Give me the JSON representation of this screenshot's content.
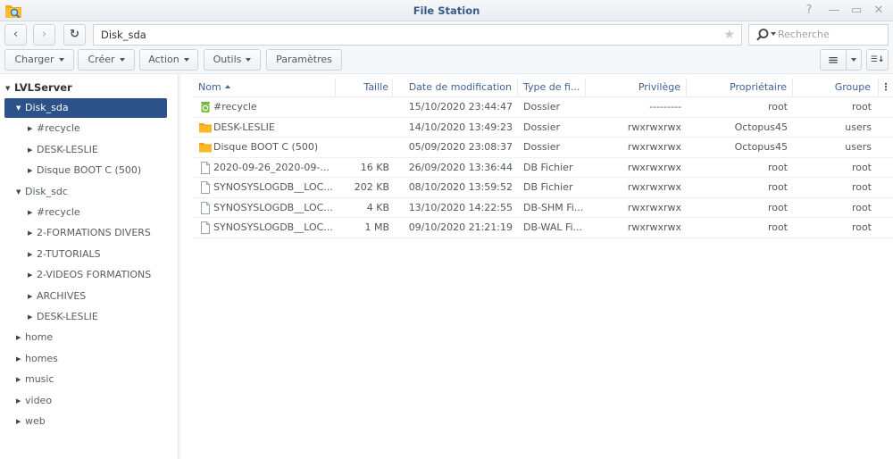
{
  "window": {
    "title": "File Station",
    "controls": [
      "help",
      "minimize",
      "maximize",
      "close"
    ],
    "control_glyphs": {
      "help": "?",
      "minimize": "—",
      "maximize": "▭",
      "close": "✕"
    }
  },
  "nav": {
    "back_glyph": "‹",
    "forward_glyph": "›",
    "refresh_glyph": "↻",
    "path": "Disk_sda",
    "favorite_glyph": "★"
  },
  "search": {
    "placeholder": "Recherche",
    "value": ""
  },
  "toolbar": {
    "buttons": [
      {
        "label": "Charger",
        "dropdown": true
      },
      {
        "label": "Créer",
        "dropdown": true
      },
      {
        "label": "Action",
        "dropdown": true
      },
      {
        "label": "Outils",
        "dropdown": true
      },
      {
        "label": "Paramètres",
        "dropdown": false
      }
    ],
    "view_list_glyph": "≡",
    "sort_glyph": "☰↓"
  },
  "sidebar": {
    "root": "LVLServer",
    "items": [
      {
        "label": "Disk_sda",
        "level": 1,
        "expanded": true,
        "selected": true
      },
      {
        "label": "#recycle",
        "level": 2,
        "expanded": false
      },
      {
        "label": "DESK-LESLIE",
        "level": 2,
        "expanded": false
      },
      {
        "label": "Disque BOOT C (500)",
        "level": 2,
        "expanded": false
      },
      {
        "label": "Disk_sdc",
        "level": 1,
        "expanded": true
      },
      {
        "label": "#recycle",
        "level": 2,
        "expanded": false
      },
      {
        "label": "2-FORMATIONS DIVERS",
        "level": 2,
        "expanded": false
      },
      {
        "label": "2-TUTORIALS",
        "level": 2,
        "expanded": false
      },
      {
        "label": "2-VIDEOS FORMATIONS",
        "level": 2,
        "expanded": false
      },
      {
        "label": "ARCHIVES",
        "level": 2,
        "expanded": false
      },
      {
        "label": "DESK-LESLIE",
        "level": 2,
        "expanded": false
      },
      {
        "label": "home",
        "level": 1,
        "expanded": false
      },
      {
        "label": "homes",
        "level": 1,
        "expanded": false
      },
      {
        "label": "music",
        "level": 1,
        "expanded": false
      },
      {
        "label": "video",
        "level": 1,
        "expanded": false
      },
      {
        "label": "web",
        "level": 1,
        "expanded": false
      }
    ]
  },
  "grid": {
    "columns": {
      "name": "Nom",
      "size": "Taille",
      "modified": "Date de modification",
      "type": "Type de fi...",
      "privilege": "Privilège",
      "owner": "Propriétaire",
      "group": "Groupe"
    },
    "column_menu_glyph": "⋮",
    "rows": [
      {
        "icon": "recycle",
        "name": "#recycle",
        "size": "",
        "modified": "15/10/2020 23:44:47",
        "type": "Dossier",
        "privilege": "---------",
        "owner": "root",
        "group": "root"
      },
      {
        "icon": "folder",
        "name": "DESK-LESLIE",
        "size": "",
        "modified": "14/10/2020 13:49:23",
        "type": "Dossier",
        "privilege": "rwxrwxrwx",
        "owner": "Octopus45",
        "group": "users"
      },
      {
        "icon": "folder",
        "name": "Disque BOOT C (500)",
        "size": "",
        "modified": "05/09/2020 23:08:37",
        "type": "Dossier",
        "privilege": "rwxrwxrwx",
        "owner": "Octopus45",
        "group": "users"
      },
      {
        "icon": "file",
        "name": "2020-09-26_2020-09-...",
        "size": "16 KB",
        "modified": "26/09/2020 13:36:44",
        "type": "DB Fichier",
        "privilege": "rwxrwxrwx",
        "owner": "root",
        "group": "root"
      },
      {
        "icon": "file",
        "name": "SYNOSYSLOGDB__LOC...",
        "size": "202 KB",
        "modified": "08/10/2020 13:59:52",
        "type": "DB Fichier",
        "privilege": "rwxrwxrwx",
        "owner": "root",
        "group": "root"
      },
      {
        "icon": "file",
        "name": "SYNOSYSLOGDB__LOC...",
        "size": "4 KB",
        "modified": "13/10/2020 14:22:55",
        "type": "DB-SHM Fi...",
        "privilege": "rwxrwxrwx",
        "owner": "root",
        "group": "root"
      },
      {
        "icon": "file",
        "name": "SYNOSYSLOGDB__LOC...",
        "size": "1 MB",
        "modified": "09/10/2020 21:21:19",
        "type": "DB-WAL Fi...",
        "privilege": "rwxrwxrwx",
        "owner": "root",
        "group": "root"
      }
    ]
  }
}
